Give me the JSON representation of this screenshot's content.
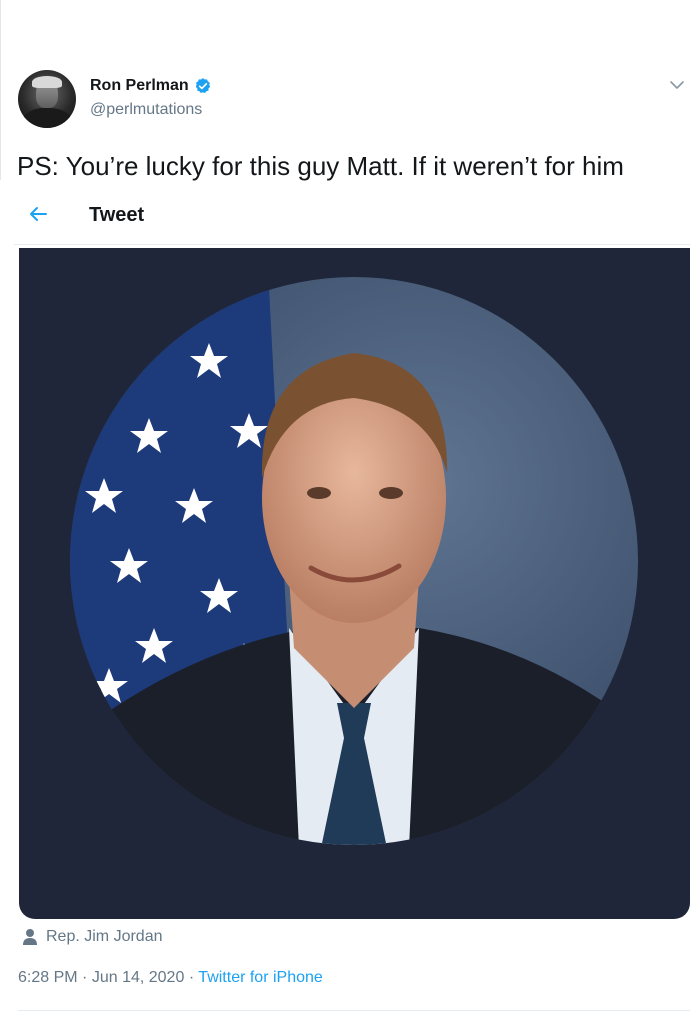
{
  "tweet": {
    "author": {
      "display_name": "Ron Perlman",
      "handle": "@perlmutations",
      "verified": true,
      "avatar_icon": "user-avatar"
    },
    "text": "PS: You’re lucky for this guy Matt. If it weren’t for him"
  },
  "overlay_bar": {
    "back_icon": "back-arrow-icon",
    "title": "Tweet"
  },
  "embedded_tweet": {
    "media_description_icon": "portrait-image",
    "author_label": "Rep. Jim Jordan",
    "time": "6:28 PM",
    "date": "Jun 14, 2020",
    "separator": "·",
    "source": "Twitter for iPhone"
  },
  "colors": {
    "accent": "#1da1f2",
    "secondary_text": "#657786",
    "media_background": "#1f2639"
  }
}
